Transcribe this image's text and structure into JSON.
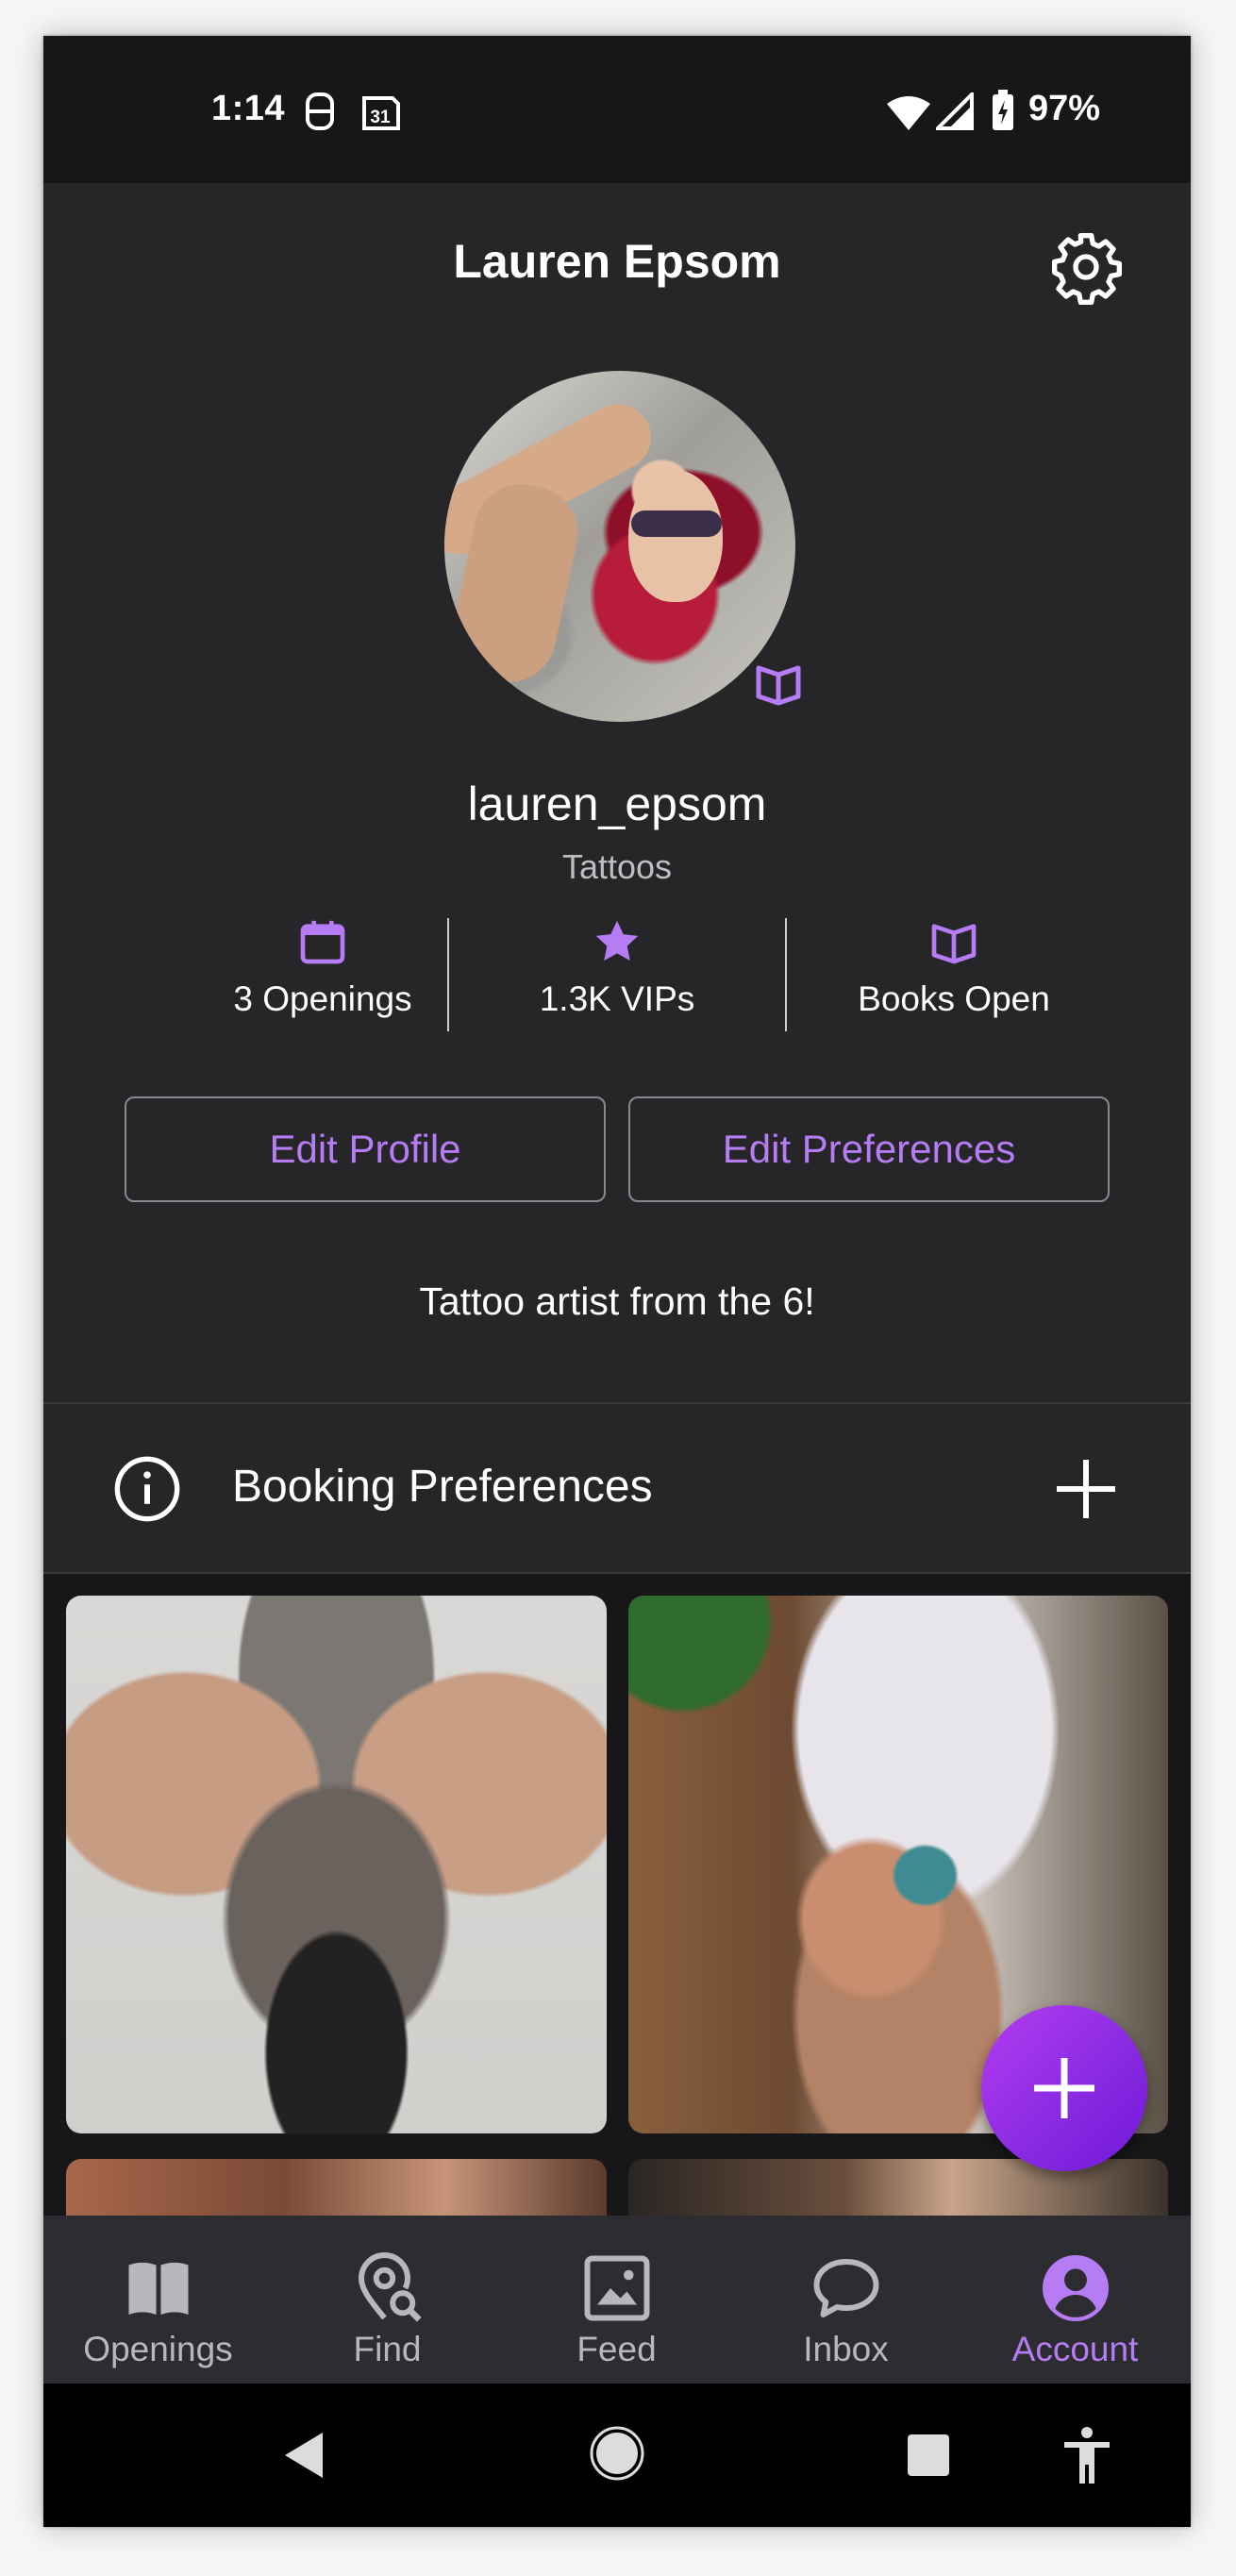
{
  "status_bar": {
    "time": "1:14",
    "calendar_day": "31",
    "battery_percent": "97%",
    "icons": [
      "notification-icon",
      "calendar-icon",
      "wifi-icon",
      "signal-icon",
      "battery-charging-icon"
    ]
  },
  "header": {
    "title": "Lauren Epsom",
    "settings_icon": "gear-icon"
  },
  "profile": {
    "username": "lauren_epsom",
    "category": "Tattoos",
    "bio": "Tattoo artist from the 6!",
    "badge_icon": "book-open-icon"
  },
  "stats": [
    {
      "icon": "calendar-icon",
      "label": "3 Openings"
    },
    {
      "icon": "star-icon",
      "label": "1.3K VIPs"
    },
    {
      "icon": "book-open-icon",
      "label": "Books Open"
    }
  ],
  "buttons": {
    "edit_profile": "Edit Profile",
    "edit_preferences": "Edit Preferences"
  },
  "booking": {
    "label": "Booking Preferences",
    "info_icon": "info-icon",
    "add_icon": "plus-icon"
  },
  "gallery": {
    "photos": [
      "neck-tattoo-photo",
      "leg-tattoo-photo",
      "arm-tattoo-photo",
      "portrait-photo"
    ]
  },
  "fab": {
    "icon": "plus-icon"
  },
  "bottom_nav": [
    {
      "label": "Openings",
      "icon": "book-icon",
      "active": false
    },
    {
      "label": "Find",
      "icon": "location-search-icon",
      "active": false
    },
    {
      "label": "Feed",
      "icon": "image-icon",
      "active": false
    },
    {
      "label": "Inbox",
      "icon": "chat-bubble-icon",
      "active": false
    },
    {
      "label": "Account",
      "icon": "account-circle-icon",
      "active": true
    }
  ],
  "colors": {
    "accent": "#b57cf4",
    "background": "#262528",
    "fab": "#8a2be2"
  }
}
